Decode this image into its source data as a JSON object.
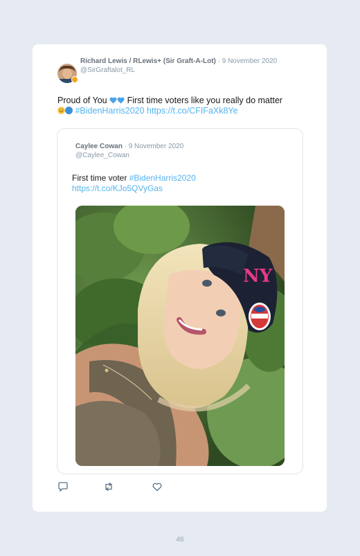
{
  "tweet": {
    "author_name": "Richard Lewis / RLewis+ (Sir Graft-A-Lot)",
    "separator": " · ",
    "date": "9 November 2020",
    "handle": "@SirGraftalot_RL",
    "text_part1": "Proud of You",
    "text_part2": " First time voters like you really do matter",
    "hashtag": "#BidenHarris2020",
    "link": "https://t.co/CFIFaXk8Ye"
  },
  "quoted_tweet": {
    "author_name": "Caylee Cowan",
    "separator": " · ",
    "date": "9 November 2020",
    "handle": "@Caylee_Cowan",
    "text": "First time voter ",
    "hashtag": "#BidenHarris2020",
    "link": "https://t.co/KJo5QVyGas",
    "photo_icon": "selfie-photo"
  },
  "actions": {
    "reply_icon": "reply-icon",
    "retweet_icon": "retweet-icon",
    "like_icon": "heart-icon"
  },
  "colors": {
    "link": "#55b3f0",
    "page_background": "#e6ebf3"
  },
  "page_number": "46"
}
